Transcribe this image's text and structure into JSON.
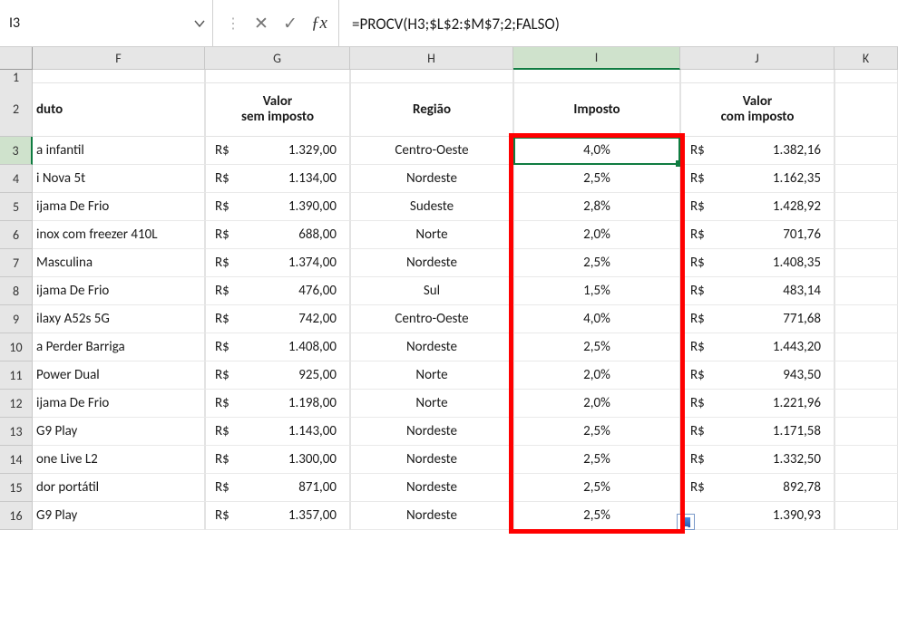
{
  "name_box": {
    "value": "I3"
  },
  "formula_bar": {
    "value": "=PROCV(H3;$L$2:$M$7;2;FALSO)"
  },
  "columns": [
    "F",
    "G",
    "H",
    "I",
    "J",
    "K"
  ],
  "row_numbers": [
    1,
    2,
    3,
    4,
    5,
    6,
    7,
    8,
    9,
    10,
    11,
    12,
    13,
    14,
    15,
    16
  ],
  "headers": {
    "F": "duto",
    "G_line1": "Valor",
    "G_line2": "sem imposto",
    "H": "Região",
    "I": "Imposto",
    "J_line1": "Valor",
    "J_line2": "com imposto"
  },
  "currency_symbol": "R$",
  "rows": [
    {
      "produto": "a infantil",
      "valor_sem": "1.329,00",
      "regiao": "Centro-Oeste",
      "imposto": "4,0%",
      "valor_com": "1.382,16"
    },
    {
      "produto": "i Nova 5t",
      "valor_sem": "1.134,00",
      "regiao": "Nordeste",
      "imposto": "2,5%",
      "valor_com": "1.162,35"
    },
    {
      "produto": "ijama De Frio",
      "valor_sem": "1.390,00",
      "regiao": "Sudeste",
      "imposto": "2,8%",
      "valor_com": "1.428,92"
    },
    {
      "produto": "inox com freezer 410L",
      "valor_sem": "688,00",
      "regiao": "Norte",
      "imposto": "2,0%",
      "valor_com": "701,76"
    },
    {
      "produto": " Masculina",
      "valor_sem": "1.374,00",
      "regiao": "Nordeste",
      "imposto": "2,5%",
      "valor_com": "1.408,35"
    },
    {
      "produto": "ijama De Frio",
      "valor_sem": "476,00",
      "regiao": "Sul",
      "imposto": "1,5%",
      "valor_com": "483,14"
    },
    {
      "produto": "ilaxy A52s 5G",
      "valor_sem": "742,00",
      "regiao": "Centro-Oeste",
      "imposto": "4,0%",
      "valor_com": "771,68"
    },
    {
      "produto": "a Perder Barriga",
      "valor_sem": "1.408,00",
      "regiao": "Nordeste",
      "imposto": "2,5%",
      "valor_com": "1.443,20"
    },
    {
      "produto": "Power Dual",
      "valor_sem": "925,00",
      "regiao": "Norte",
      "imposto": "2,0%",
      "valor_com": "943,50"
    },
    {
      "produto": "ijama De Frio",
      "valor_sem": "1.198,00",
      "regiao": "Norte",
      "imposto": "2,0%",
      "valor_com": "1.221,96"
    },
    {
      "produto": " G9 Play",
      "valor_sem": "1.143,00",
      "regiao": "Nordeste",
      "imposto": "2,5%",
      "valor_com": "1.171,58"
    },
    {
      "produto": "one Live L2",
      "valor_sem": "1.300,00",
      "regiao": "Nordeste",
      "imposto": "2,5%",
      "valor_com": "1.332,50"
    },
    {
      "produto": "dor portátil",
      "valor_sem": "871,00",
      "regiao": "Nordeste",
      "imposto": "2,5%",
      "valor_com": "892,78"
    },
    {
      "produto": " G9 Play",
      "valor_sem": "1.357,00",
      "regiao": "Nordeste",
      "imposto": "2,5%",
      "valor_com": "1.390,93"
    }
  ],
  "selected_cell": "I3",
  "selected_column": "I"
}
